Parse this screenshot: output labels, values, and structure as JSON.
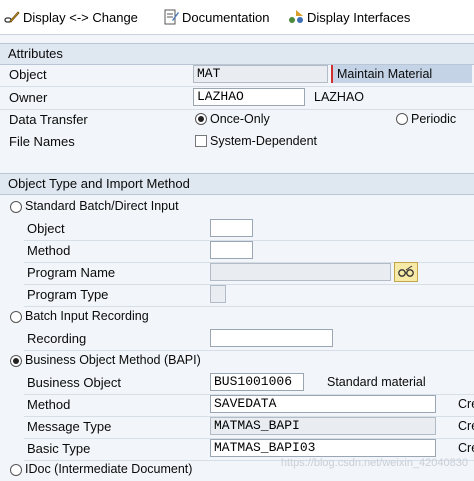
{
  "toolbar": {
    "display_change": "Display <-> Change",
    "documentation": "Documentation",
    "display_interfaces": "Display Interfaces"
  },
  "attributes": {
    "header": "Attributes",
    "object_label": "Object",
    "object_value": "MAT",
    "object_description": "Maintain Material",
    "owner_label": "Owner",
    "owner_value": "LAZHAO",
    "owner_name": "LAZHAO",
    "data_transfer_label": "Data Transfer",
    "once_only": "Once-Only",
    "periodic": "Periodic",
    "file_names_label": "File Names",
    "system_dependent": "System-Dependent"
  },
  "import_method": {
    "header": "Object Type and Import Method",
    "standard_batch": "Standard Batch/Direct Input",
    "object_label": "Object",
    "method_label": "Method",
    "program_name_label": "Program Name",
    "program_type_label": "Program Type",
    "batch_input_recording": "Batch Input Recording",
    "recording_label": "Recording",
    "business_object_method": "Business Object Method  (BAPI)",
    "business_object_label": "Business Object",
    "business_object_value": "BUS1001006",
    "business_object_desc": "Standard material",
    "method2_label": "Method",
    "method2_value": "SAVEDATA",
    "method2_desc": "Cre",
    "message_type_label": "Message Type",
    "message_type_value": "MATMAS_BAPI",
    "message_type_desc": "Cre",
    "basic_type_label": "Basic Type",
    "basic_type_value": "MATMAS_BAPI03",
    "basic_type_desc": "Cre",
    "idoc": "IDoc (Intermediate Document)"
  },
  "watermark": "https://blog.csdn.net/weixin_42040830"
}
